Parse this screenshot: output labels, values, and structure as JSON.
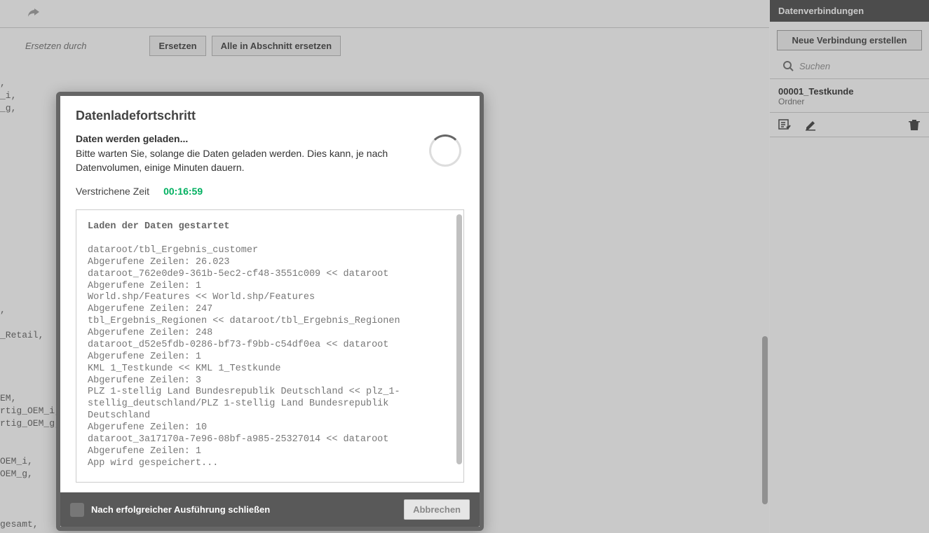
{
  "toolbar": {
    "replace_label": "Ersetzen durch",
    "replace_btn": "Ersetzen",
    "replace_all_btn": "Alle in Abschnitt ersetzen"
  },
  "code_bg": ",\n_i,\n_g,\n\n\n\n\n\n\n\n\n\n\n\n\n\n\n\n,\n\n_Retail,\n\n\n\n\nEM,\nrtig_OEM_i,\nrtig_OEM_g,\n\n\nOEM_i,\nOEM_g,\n\n\n\ngesamt,",
  "dialog": {
    "title": "Datenladefortschritt",
    "loading": "Daten werden geladen...",
    "desc": "Bitte warten Sie, solange die Daten geladen werden. Dies kann, je nach Datenvolumen, einige Minuten dauern.",
    "time_label": "Verstrichene Zeit",
    "time_value": "00:16:59",
    "log_head": "Laden der Daten gestartet",
    "log_body": "dataroot/tbl_Ergebnis_customer\nAbgerufene Zeilen: 26.023\ndataroot_762e0de9-361b-5ec2-cf48-3551c009 << dataroot\nAbgerufene Zeilen: 1\nWorld.shp/Features << World.shp/Features\nAbgerufene Zeilen: 247\ntbl_Ergebnis_Regionen << dataroot/tbl_Ergebnis_Regionen\nAbgerufene Zeilen: 248\ndataroot_d52e5fdb-0286-bf73-f9bb-c54df0ea << dataroot\nAbgerufene Zeilen: 1\nKML 1_Testkunde << KML 1_Testkunde\nAbgerufene Zeilen: 3\nPLZ 1-stellig Land Bundesrepublik Deutschland << plz_1-stellig_deutschland/PLZ 1-stellig Land Bundesrepublik Deutschland\nAbgerufene Zeilen: 10\ndataroot_3a17170a-7e96-08bf-a985-25327014 << dataroot\nAbgerufene Zeilen: 1\nApp wird gespeichert...",
    "footer_check": "Nach erfolgreicher Ausführung schließen",
    "cancel": "Abbrechen"
  },
  "right": {
    "header": "Datenverbindungen",
    "new_btn": "Neue Verbindung erstellen",
    "search_placeholder": "Suchen",
    "item_title": "00001_Testkunde",
    "item_sub": "Ordner"
  }
}
